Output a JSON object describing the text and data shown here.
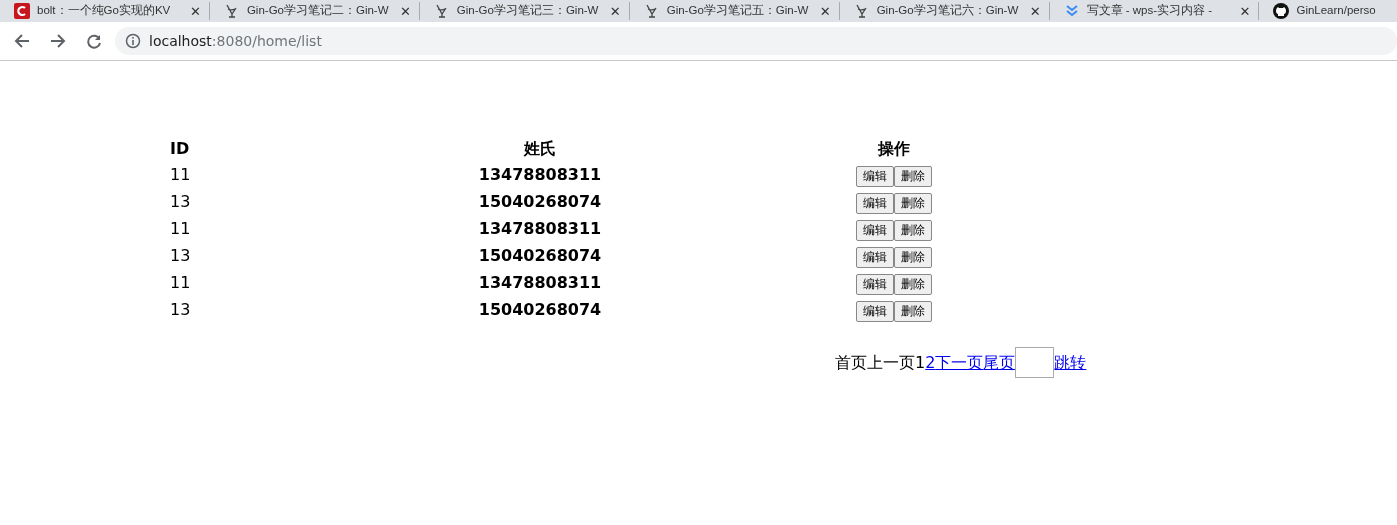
{
  "browser": {
    "tabs": [
      {
        "title": "bolt：一个纯Go实现的KV",
        "kind": "red"
      },
      {
        "title": "Gin-Go学习笔记二：Gin-W",
        "kind": "gin"
      },
      {
        "title": "Gin-Go学习笔记三：Gin-W",
        "kind": "gin"
      },
      {
        "title": "Gin-Go学习笔记五：Gin-W",
        "kind": "gin"
      },
      {
        "title": "Gin-Go学习笔记六：Gin-W",
        "kind": "gin"
      },
      {
        "title": "写文章 - wps-实习内容 -",
        "kind": "chevron"
      },
      {
        "title": "GinLearn/perso",
        "kind": "github"
      }
    ],
    "tab_close": "✕",
    "address": {
      "host": "localhost",
      "rest": ":8080/home/list"
    }
  },
  "table": {
    "columns": [
      "ID",
      "姓氏",
      "操作"
    ],
    "rows": [
      {
        "id": "11",
        "name": "13478808311",
        "actions": [
          "编辑",
          "删除"
        ]
      },
      {
        "id": "13",
        "name": "15040268074",
        "actions": [
          "编辑",
          "删除"
        ]
      },
      {
        "id": "11",
        "name": "13478808311",
        "actions": [
          "编辑",
          "删除"
        ]
      },
      {
        "id": "13",
        "name": "15040268074",
        "actions": [
          "编辑",
          "删除"
        ]
      },
      {
        "id": "11",
        "name": "13478808311",
        "actions": [
          "编辑",
          "删除"
        ]
      },
      {
        "id": "13",
        "name": "15040268074",
        "actions": [
          "编辑",
          "删除"
        ]
      }
    ]
  },
  "pagination": {
    "items": [
      {
        "text": "首页",
        "kind": "text"
      },
      {
        "text": "上一页",
        "kind": "text"
      },
      {
        "text": "1",
        "kind": "text"
      },
      {
        "text": "2",
        "kind": "link"
      },
      {
        "text": "下一页",
        "kind": "link"
      },
      {
        "text": "尾页",
        "kind": "link"
      }
    ],
    "jump": "跳转"
  }
}
